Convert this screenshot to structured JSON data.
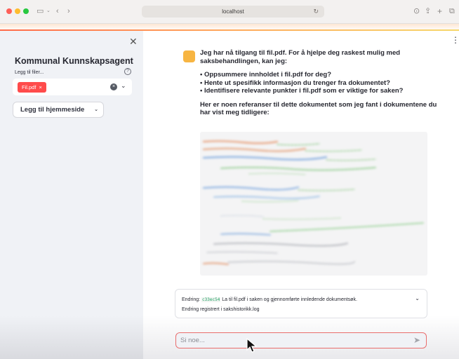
{
  "browser": {
    "url": "localhost"
  },
  "sidebar": {
    "title": "Kommunal Kunnskapsagent",
    "file_label": "Legg til filer...",
    "selected_file": "Fil.pdf",
    "chip_close": "×",
    "homepage_button": "Legg til hjemmeside"
  },
  "chat": {
    "assistant_message": {
      "intro": "Jeg har nå tilgang til fil.pdf.  For å hjelpe deg raskest mulig med saksbehandlingen, kan jeg:",
      "options": [
        "Oppsummere innholdet i fil.pdf for deg?",
        "Hente ut spesifikk informasjon du trenger fra dokumentet?",
        "Identifisere relevante punkter i fil.pdf som er viktige for saken?"
      ],
      "references_intro": "Her er noen referanser til dette dokumentet som jeg fant i dokumentene du har vist meg tidligere:"
    },
    "change_log": {
      "label": "Endring:",
      "commit": "c33ec54",
      "description": "La til fil.pdf i saken og gjennomførte innledende dokumentsøk.",
      "registered": "Endring registrert i sakshistorikk.log"
    },
    "input_placeholder": "Si noe..."
  },
  "colors": {
    "accent": "#ff4b4b",
    "avatar": "#f7b542",
    "sidebar_bg": "#f0f2f6"
  }
}
